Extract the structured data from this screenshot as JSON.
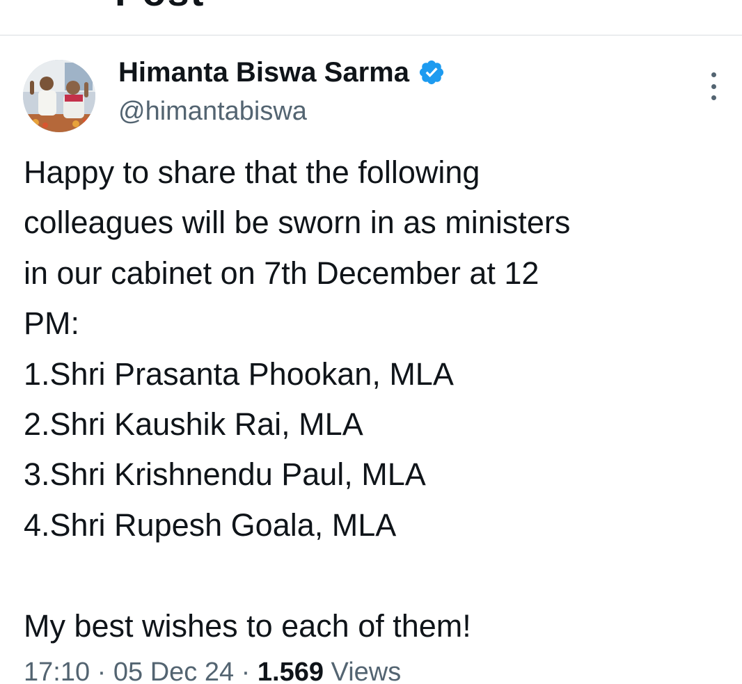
{
  "header": {
    "title_fragment": "Post"
  },
  "author": {
    "display_name": "Himanta Biswa Sarma",
    "handle": "@himantabiswa",
    "verified": true,
    "verified_color": "#1d9bf0"
  },
  "tweet": {
    "lines": [
      "Happy to share that the following",
      "colleagues will be sworn in as ministers",
      "in our cabinet on 7th December at 12",
      "PM:",
      "1.Shri Prasanta Phookan, MLA",
      "2.Shri Kaushik Rai, MLA",
      "3.Shri Krishnendu Paul, MLA",
      "4.Shri Rupesh Goala, MLA",
      "",
      "My best wishes to each of them!"
    ]
  },
  "meta": {
    "time": "17:10",
    "separator": "·",
    "date": "05 Dec 24",
    "views_count": "1.569",
    "views_label": "Views"
  },
  "icons": {
    "verified": "verified-badge-icon",
    "more": "more-options-icon"
  }
}
